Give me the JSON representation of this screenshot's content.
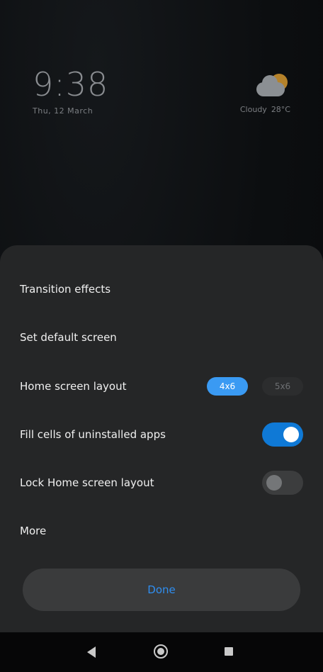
{
  "wallpaper": {
    "clock": {
      "time": "9:38",
      "date": "Thu, 12 March"
    },
    "weather": {
      "icon": "partly-cloudy-icon",
      "condition": "Cloudy",
      "temperature": "28°C"
    }
  },
  "sheet": {
    "items": [
      {
        "label": "Transition effects"
      },
      {
        "label": "Set default screen"
      },
      {
        "label": "Home screen layout",
        "options": [
          "4x6",
          "5x6"
        ],
        "selected": "4x6"
      },
      {
        "label": "Fill cells of uninstalled apps",
        "toggle": true
      },
      {
        "label": "Lock Home screen layout",
        "toggle": false
      },
      {
        "label": "More"
      }
    ],
    "done_label": "Done"
  },
  "navbar": {
    "icons": [
      "back-icon",
      "home-icon",
      "recents-icon"
    ]
  },
  "colors": {
    "accent": "#3a9af3",
    "toggle_on": "#0f79d6",
    "sheet_bg": "#252627",
    "done_text": "#2f8ef0"
  }
}
